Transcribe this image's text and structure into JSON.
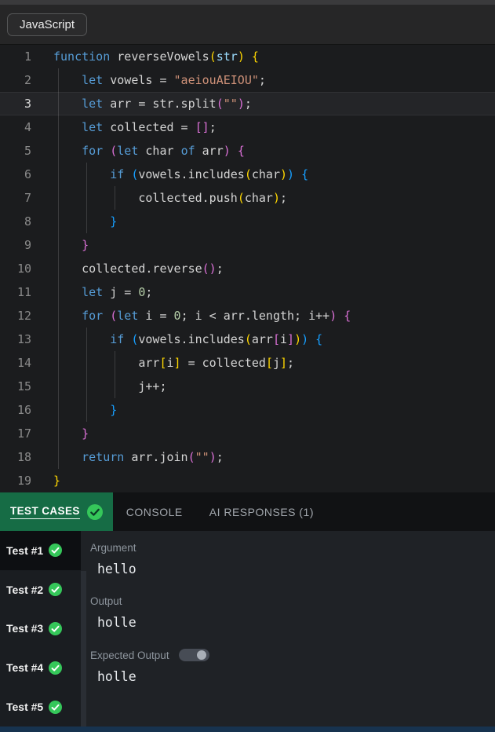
{
  "header": {
    "language_button": "JavaScript"
  },
  "editor": {
    "active_line": 3,
    "lines": [
      {
        "n": 1,
        "tokens": [
          [
            "kw",
            "function"
          ],
          [
            "id",
            " reverseVowels"
          ],
          [
            "b1",
            "("
          ],
          [
            "param",
            "str"
          ],
          [
            "b1",
            ")"
          ],
          [
            "pun",
            " "
          ],
          [
            "b1",
            "{"
          ]
        ]
      },
      {
        "n": 2,
        "tokens": [
          [
            "pun",
            "    "
          ],
          [
            "kw",
            "let"
          ],
          [
            "pun",
            " vowels = "
          ],
          [
            "str",
            "\"aeiouAEIOU\""
          ],
          [
            "pun",
            ";"
          ]
        ]
      },
      {
        "n": 3,
        "tokens": [
          [
            "pun",
            "    "
          ],
          [
            "kw",
            "let"
          ],
          [
            "pun",
            " arr = str.split"
          ],
          [
            "b2",
            "("
          ],
          [
            "str",
            "\"\""
          ],
          [
            "b2",
            ")"
          ],
          [
            "pun",
            ";"
          ]
        ]
      },
      {
        "n": 4,
        "tokens": [
          [
            "pun",
            "    "
          ],
          [
            "kw",
            "let"
          ],
          [
            "pun",
            " collected = "
          ],
          [
            "b2",
            "[]"
          ],
          [
            "pun",
            ";"
          ]
        ]
      },
      {
        "n": 5,
        "tokens": [
          [
            "pun",
            "    "
          ],
          [
            "kw",
            "for"
          ],
          [
            "pun",
            " "
          ],
          [
            "b2",
            "("
          ],
          [
            "kw",
            "let"
          ],
          [
            "pun",
            " char "
          ],
          [
            "kw",
            "of"
          ],
          [
            "pun",
            " arr"
          ],
          [
            "b2",
            ")"
          ],
          [
            "pun",
            " "
          ],
          [
            "b2",
            "{"
          ]
        ]
      },
      {
        "n": 6,
        "tokens": [
          [
            "pun",
            "        "
          ],
          [
            "kw",
            "if"
          ],
          [
            "pun",
            " "
          ],
          [
            "b3",
            "("
          ],
          [
            "pun",
            "vowels.includes"
          ],
          [
            "b1",
            "("
          ],
          [
            "pun",
            "char"
          ],
          [
            "b1",
            ")"
          ],
          [
            "b3",
            ")"
          ],
          [
            "pun",
            " "
          ],
          [
            "b3",
            "{"
          ]
        ]
      },
      {
        "n": 7,
        "tokens": [
          [
            "pun",
            "            collected.push"
          ],
          [
            "b1",
            "("
          ],
          [
            "pun",
            "char"
          ],
          [
            "b1",
            ")"
          ],
          [
            "pun",
            ";"
          ]
        ]
      },
      {
        "n": 8,
        "tokens": [
          [
            "pun",
            "        "
          ],
          [
            "b3",
            "}"
          ]
        ]
      },
      {
        "n": 9,
        "tokens": [
          [
            "pun",
            "    "
          ],
          [
            "b2",
            "}"
          ]
        ]
      },
      {
        "n": 10,
        "tokens": [
          [
            "pun",
            "    collected.reverse"
          ],
          [
            "b2",
            "()"
          ],
          [
            "pun",
            ";"
          ]
        ]
      },
      {
        "n": 11,
        "tokens": [
          [
            "pun",
            "    "
          ],
          [
            "kw",
            "let"
          ],
          [
            "pun",
            " j = "
          ],
          [
            "num",
            "0"
          ],
          [
            "pun",
            ";"
          ]
        ]
      },
      {
        "n": 12,
        "tokens": [
          [
            "pun",
            "    "
          ],
          [
            "kw",
            "for"
          ],
          [
            "pun",
            " "
          ],
          [
            "b2",
            "("
          ],
          [
            "kw",
            "let"
          ],
          [
            "pun",
            " i = "
          ],
          [
            "num",
            "0"
          ],
          [
            "pun",
            "; i < arr.length; i++"
          ],
          [
            "b2",
            ")"
          ],
          [
            "pun",
            " "
          ],
          [
            "b2",
            "{"
          ]
        ]
      },
      {
        "n": 13,
        "tokens": [
          [
            "pun",
            "        "
          ],
          [
            "kw",
            "if"
          ],
          [
            "pun",
            " "
          ],
          [
            "b3",
            "("
          ],
          [
            "pun",
            "vowels.includes"
          ],
          [
            "b1",
            "("
          ],
          [
            "pun",
            "arr"
          ],
          [
            "b2",
            "["
          ],
          [
            "pun",
            "i"
          ],
          [
            "b2",
            "]"
          ],
          [
            "b1",
            ")"
          ],
          [
            "b3",
            ")"
          ],
          [
            "pun",
            " "
          ],
          [
            "b3",
            "{"
          ]
        ]
      },
      {
        "n": 14,
        "tokens": [
          [
            "pun",
            "            arr"
          ],
          [
            "b1",
            "["
          ],
          [
            "pun",
            "i"
          ],
          [
            "b1",
            "]"
          ],
          [
            "pun",
            " = collected"
          ],
          [
            "b1",
            "["
          ],
          [
            "pun",
            "j"
          ],
          [
            "b1",
            "]"
          ],
          [
            "pun",
            ";"
          ]
        ]
      },
      {
        "n": 15,
        "tokens": [
          [
            "pun",
            "            j++;"
          ]
        ]
      },
      {
        "n": 16,
        "tokens": [
          [
            "pun",
            "        "
          ],
          [
            "b3",
            "}"
          ]
        ]
      },
      {
        "n": 17,
        "tokens": [
          [
            "pun",
            "    "
          ],
          [
            "b2",
            "}"
          ]
        ]
      },
      {
        "n": 18,
        "tokens": [
          [
            "pun",
            "    "
          ],
          [
            "kw",
            "return"
          ],
          [
            "pun",
            " arr.join"
          ],
          [
            "b2",
            "("
          ],
          [
            "str",
            "\"\""
          ],
          [
            "b2",
            ")"
          ],
          [
            "pun",
            ";"
          ]
        ]
      },
      {
        "n": 19,
        "tokens": [
          [
            "b1",
            "}"
          ]
        ]
      }
    ]
  },
  "tabs": {
    "test_cases": "TEST CASES",
    "console": "CONSOLE",
    "ai_responses": "AI RESPONSES (1)"
  },
  "tests": {
    "selected": "Test #1",
    "items": [
      {
        "label": "Test #1",
        "status": "pass"
      },
      {
        "label": "Test #2",
        "status": "pass"
      },
      {
        "label": "Test #3",
        "status": "pass"
      },
      {
        "label": "Test #4",
        "status": "pass"
      },
      {
        "label": "Test #5",
        "status": "pass"
      }
    ]
  },
  "detail": {
    "argument_label": "Argument",
    "argument_value": "hello",
    "output_label": "Output",
    "output_value": "holle",
    "expected_label": "Expected Output",
    "expected_toggle_on": true,
    "expected_value": "holle"
  },
  "colors": {
    "active_tab_green": "#166c45",
    "pass_check_green": "#35c75a",
    "status_bar_blue": "#17334f",
    "keyword_blue": "#569cd6",
    "string_orange": "#ce9178"
  }
}
